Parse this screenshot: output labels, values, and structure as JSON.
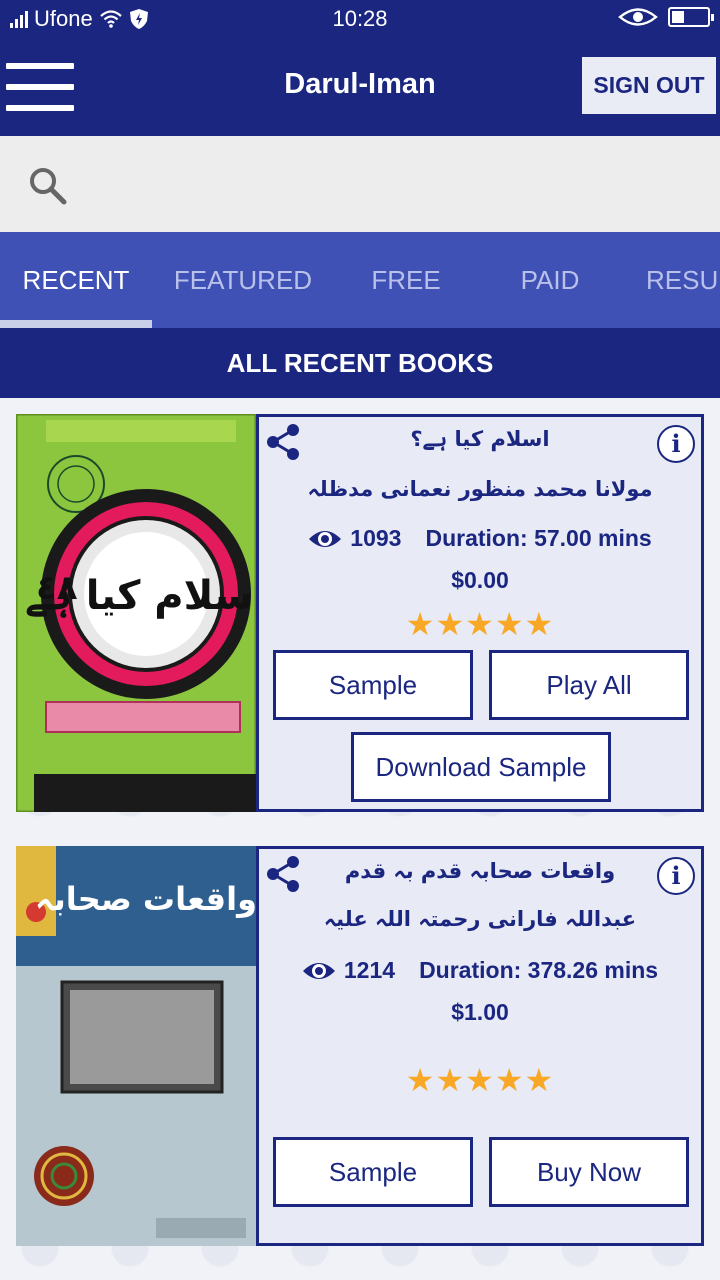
{
  "status": {
    "carrier": "Ufone",
    "time": "10:28"
  },
  "header": {
    "title": "Darul-Iman",
    "sign_out_label": "SIGN OUT"
  },
  "search": {
    "placeholder": ""
  },
  "tabs": [
    {
      "label": "RECENT",
      "active": true
    },
    {
      "label": "FEATURED",
      "active": false
    },
    {
      "label": "FREE",
      "active": false
    },
    {
      "label": "PAID",
      "active": false
    },
    {
      "label": "RESULTS",
      "active": false
    }
  ],
  "section_title": "ALL RECENT BOOKS",
  "books": [
    {
      "title": "اسلام کیا ہے؟",
      "author": "مولانا محمد منظور نعمانی مدظلہ",
      "views": "1093",
      "duration": "Duration: 57.00 mins",
      "price": "$0.00",
      "rating": 5,
      "stars": "★★★★★",
      "buttons": [
        "Sample",
        "Play All",
        "Download Sample"
      ],
      "cover_text": "اسلام کیا ہے"
    },
    {
      "title": "واقعات صحابہ قدم بہ قدم",
      "author": "عبداللہ فارانی رحمتہ اللہ علیہ",
      "views": "1214",
      "duration": "Duration: 378.26 mins",
      "price": "$1.00",
      "rating": 5,
      "stars": "★★★★★",
      "buttons": [
        "Sample",
        "Buy Now"
      ],
      "cover_text": "واقعات صحابہ"
    }
  ],
  "colors": {
    "primary": "#1b2680",
    "tab_bar": "#3f51b5",
    "star": "#f9a825",
    "cover1_bg": "#8cc63f",
    "cover2_bg": "#b7c7cf"
  }
}
